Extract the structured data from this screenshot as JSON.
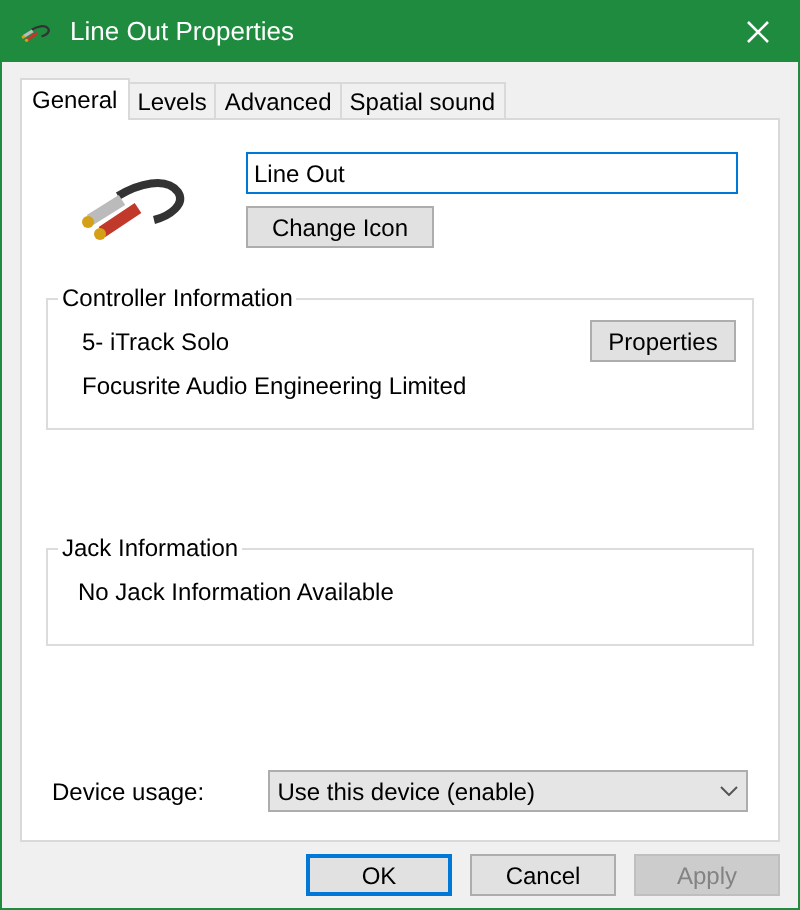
{
  "window": {
    "title": "Line Out Properties"
  },
  "tabs": [
    {
      "label": "General",
      "selected": true
    },
    {
      "label": "Levels",
      "selected": false
    },
    {
      "label": "Advanced",
      "selected": false
    },
    {
      "label": "Spatial sound",
      "selected": false
    }
  ],
  "name_field": {
    "value": "Line Out"
  },
  "change_icon_button": {
    "label": "Change Icon"
  },
  "controller_information": {
    "title": "Controller Information",
    "lines": [
      "5- iTrack Solo",
      "Focusrite Audio Engineering Limited"
    ],
    "properties_button": {
      "label": "Properties"
    }
  },
  "jack_information": {
    "title": "Jack Information",
    "text": "No Jack Information Available"
  },
  "device_usage": {
    "label": "Device usage:",
    "value": "Use this device (enable)"
  },
  "buttons": [
    {
      "label": "OK",
      "default": true,
      "disabled": false
    },
    {
      "label": "Cancel",
      "default": false,
      "disabled": false
    },
    {
      "label": "Apply",
      "default": false,
      "disabled": true
    }
  ]
}
